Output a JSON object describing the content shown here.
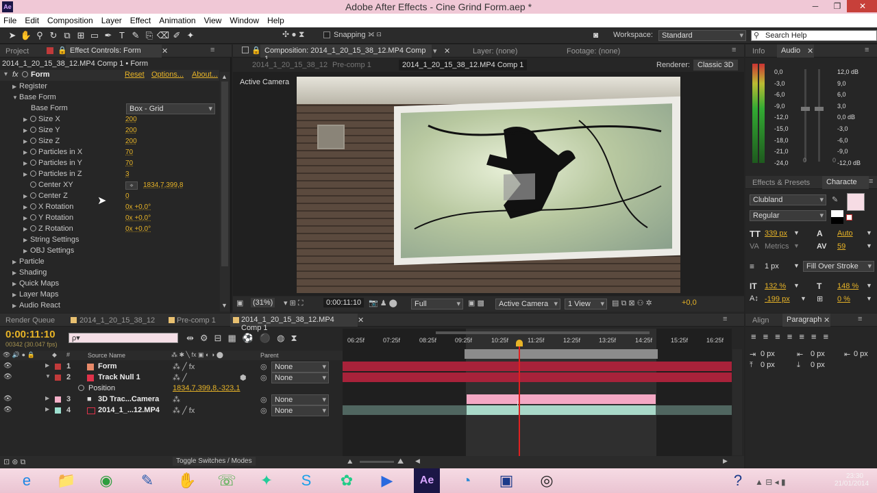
{
  "app": {
    "title": "Adobe After Effects - Cine Grind Form.aep *",
    "icon_label": "Ae"
  },
  "menu": [
    "File",
    "Edit",
    "Composition",
    "Layer",
    "Effect",
    "Animation",
    "View",
    "Window",
    "Help"
  ],
  "toolbar": {
    "snapping_label": "Snapping",
    "workspace_label": "Workspace:",
    "workspace_value": "Standard",
    "search_placeholder": "Search Help"
  },
  "left_panel": {
    "tabs": {
      "project": "Project",
      "effect_controls": "Effect Controls: Form"
    },
    "breadcrumb": "2014_1_20_15_38_12.MP4 Comp 1 • Form",
    "effect": {
      "name": "Form",
      "reset": "Reset",
      "options": "Options...",
      "about": "About..."
    },
    "groups": {
      "register": "Register",
      "base_form": "Base Form",
      "base_form_label": "Base Form",
      "base_form_value": "Box - Grid"
    },
    "props": [
      {
        "label": "Size X",
        "value": "200"
      },
      {
        "label": "Size Y",
        "value": "200"
      },
      {
        "label": "Size Z",
        "value": "200"
      },
      {
        "label": "Particles in X",
        "value": "70"
      },
      {
        "label": "Particles in Y",
        "value": "70"
      },
      {
        "label": "Particles in Z",
        "value": "3"
      },
      {
        "label": "Center XY",
        "value": "1834,7,399,8"
      },
      {
        "label": "Center Z",
        "value": "0"
      },
      {
        "label": "X Rotation",
        "value": "0x +0,0°"
      },
      {
        "label": "Y Rotation",
        "value": "0x +0,0°"
      },
      {
        "label": "Z Rotation",
        "value": "0x +0,0°"
      }
    ],
    "subgroups": [
      "String Settings",
      "OBJ Settings"
    ],
    "sections": [
      "Particle",
      "Shading",
      "Quick Maps",
      "Layer Maps",
      "Audio React"
    ]
  },
  "composition": {
    "tab": "Composition: 2014_1_20_15_38_12.MP4 Comp 1",
    "layer_tab": "Layer: (none)",
    "footage_tab": "Footage: (none)",
    "crumbs": [
      "2014_1_20_15_38_12",
      "Pre-comp 1",
      "2014_1_20_15_38_12.MP4 Comp 1"
    ],
    "renderer_label": "Renderer:",
    "renderer_value": "Classic 3D",
    "camera_label": "Active Camera",
    "footer": {
      "zoom": "(31%)",
      "timecode": "0:00:11:10",
      "resolution": "Full",
      "camera": "Active Camera",
      "view": "1 View",
      "exposure": "+0,0"
    }
  },
  "audio_panel": {
    "tabs": {
      "info": "Info",
      "audio": "Audio"
    },
    "left_scale": [
      "0,0",
      "-3,0",
      "-6,0",
      "-9,0",
      "-12,0",
      "-15,0",
      "-18,0",
      "-21,0",
      "-24,0"
    ],
    "right_scale": [
      "12,0 dB",
      "9,0",
      "6,0",
      "3,0",
      "0,0 dB",
      "-3,0",
      "-6,0",
      "-9,0",
      "-12,0 dB"
    ],
    "slider_bottom": [
      "0",
      "0"
    ]
  },
  "character_panel": {
    "tabs": {
      "effects": "Effects & Presets",
      "character": "Characte"
    },
    "font": "Clubland",
    "style": "Regular",
    "size": "339 px",
    "leading": "Auto",
    "kerning": "Metrics",
    "tracking": "59",
    "stroke_width": "1 px",
    "stroke_type": "Fill Over Stroke",
    "vscale": "132 %",
    "hscale": "148 %",
    "baseline": "-199 px",
    "tsume": "0 %",
    "fill_color": "#f6dce4"
  },
  "paragraph_panel": {
    "tabs": {
      "align": "Align",
      "paragraph": "Paragraph"
    },
    "indents": [
      "0 px",
      "0 px",
      "0 px",
      "0 px",
      "0 px"
    ]
  },
  "timeline": {
    "tabs": [
      "Render Queue",
      "2014_1_20_15_38_12",
      "Pre-comp 1",
      "2014_1_20_15_38_12.MP4 Comp 1"
    ],
    "timecode": "0:00:11:10",
    "frame_info": "00342 (30.047 fps)",
    "search_placeholder": "ρ▾",
    "col_source": "Source Name",
    "col_parent": "Parent",
    "ruler": [
      "06:25f",
      "07:25f",
      "08:25f",
      "09:25f",
      "10:25f",
      "11:25f",
      "12:25f",
      "13:25f",
      "14:25f",
      "15:25f",
      "16:25f"
    ],
    "layers": [
      {
        "num": "1",
        "name": "Form",
        "color": "#e88a6a",
        "parent": "None"
      },
      {
        "num": "2",
        "name": "Track Null 1",
        "color": "#e0324a",
        "parent": "None"
      },
      {
        "num": "3",
        "name": "3D Trac...Camera",
        "color": "#f4b0c8",
        "parent": "None"
      },
      {
        "num": "4",
        "name": "2014_1_...12.MP4",
        "color": "#9ee0d0",
        "parent": "None"
      }
    ],
    "position_label": "Position",
    "position_value": "1834,7,399,8,-323,1",
    "toggle_label": "Toggle Switches / Modes",
    "colors": {
      "red_bar": "#a8223a",
      "pink_bar": "#f4a8c4",
      "teal_bar": "#a8d8c8",
      "playhead": "#e02020"
    }
  },
  "taskbar": {
    "time": "23:30",
    "date": "21/01/2014"
  }
}
